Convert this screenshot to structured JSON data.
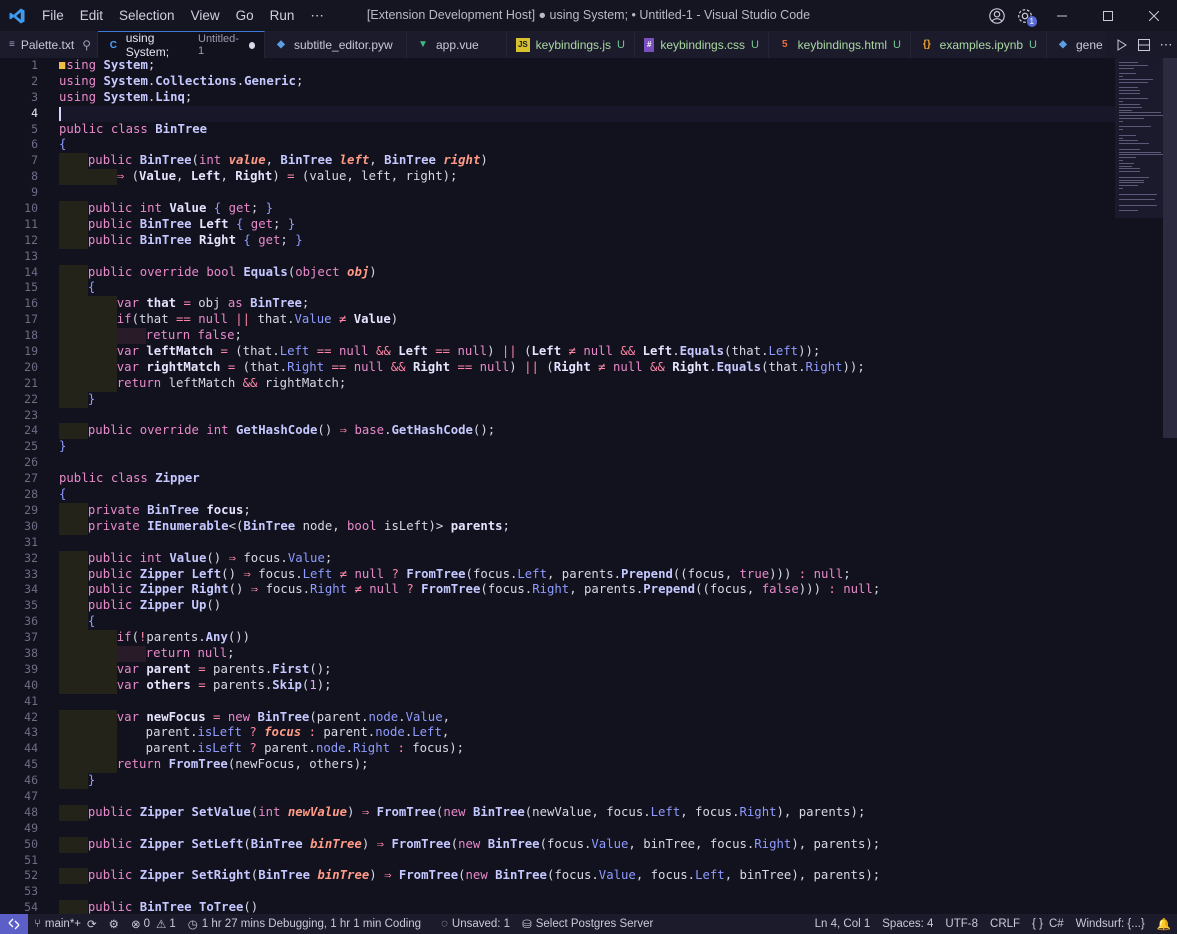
{
  "titlebar": {
    "menu": [
      "File",
      "Edit",
      "Selection",
      "View",
      "Go",
      "Run",
      "⋯"
    ],
    "title": "[Extension Development Host] ● using System; • Untitled-1 - Visual Studio Code",
    "badge_count": "1"
  },
  "tabs": [
    {
      "label": "Palette.txt",
      "icon": "text-file-icon",
      "pinned": true
    },
    {
      "label": "using System;",
      "sub": "Untitled-1",
      "icon": "csharp-file-icon",
      "active": true,
      "dirty": true
    },
    {
      "label": "subtitle_editor.pyw",
      "icon": "python-file-icon"
    },
    {
      "label": "app.vue",
      "icon": "vue-file-icon"
    },
    {
      "label": "keybindings.js",
      "icon": "js-file-icon",
      "status": "U"
    },
    {
      "label": "keybindings.css",
      "icon": "css-file-icon",
      "status": "U"
    },
    {
      "label": "keybindings.html",
      "icon": "html-file-icon",
      "status": "U"
    },
    {
      "label": "examples.ipynb",
      "icon": "notebook-file-icon",
      "status": "U"
    },
    {
      "label": "gene",
      "icon": "python-file-icon"
    }
  ],
  "editor": {
    "line_numbers": [
      "1",
      "2",
      "3",
      "4",
      "5",
      "6",
      "7",
      "8",
      "9",
      "10",
      "11",
      "12",
      "13",
      "14",
      "15",
      "16",
      "17",
      "18",
      "19",
      "20",
      "21",
      "22",
      "23",
      "24",
      "25",
      "26",
      "27",
      "28",
      "29",
      "30",
      "31",
      "32",
      "33",
      "34",
      "35",
      "36",
      "37",
      "38",
      "39",
      "40",
      "41",
      "42",
      "43",
      "44",
      "45",
      "46",
      "47",
      "48",
      "49",
      "50",
      "51",
      "52",
      "53",
      "54"
    ],
    "current_line": 4
  },
  "statusbar": {
    "branch": "main*+",
    "errors": "0",
    "warnings": "1",
    "time_tracking": "1 hr 27 mins Debugging, 1 hr 1 min Coding",
    "unsaved": "Unsaved: 1",
    "db": "Select Postgres Server",
    "position": "Ln 4, Col 1",
    "spaces": "Spaces: 4",
    "encoding": "UTF-8",
    "eol": "CRLF",
    "language": "C#",
    "extension": "Windsurf: {...}"
  }
}
